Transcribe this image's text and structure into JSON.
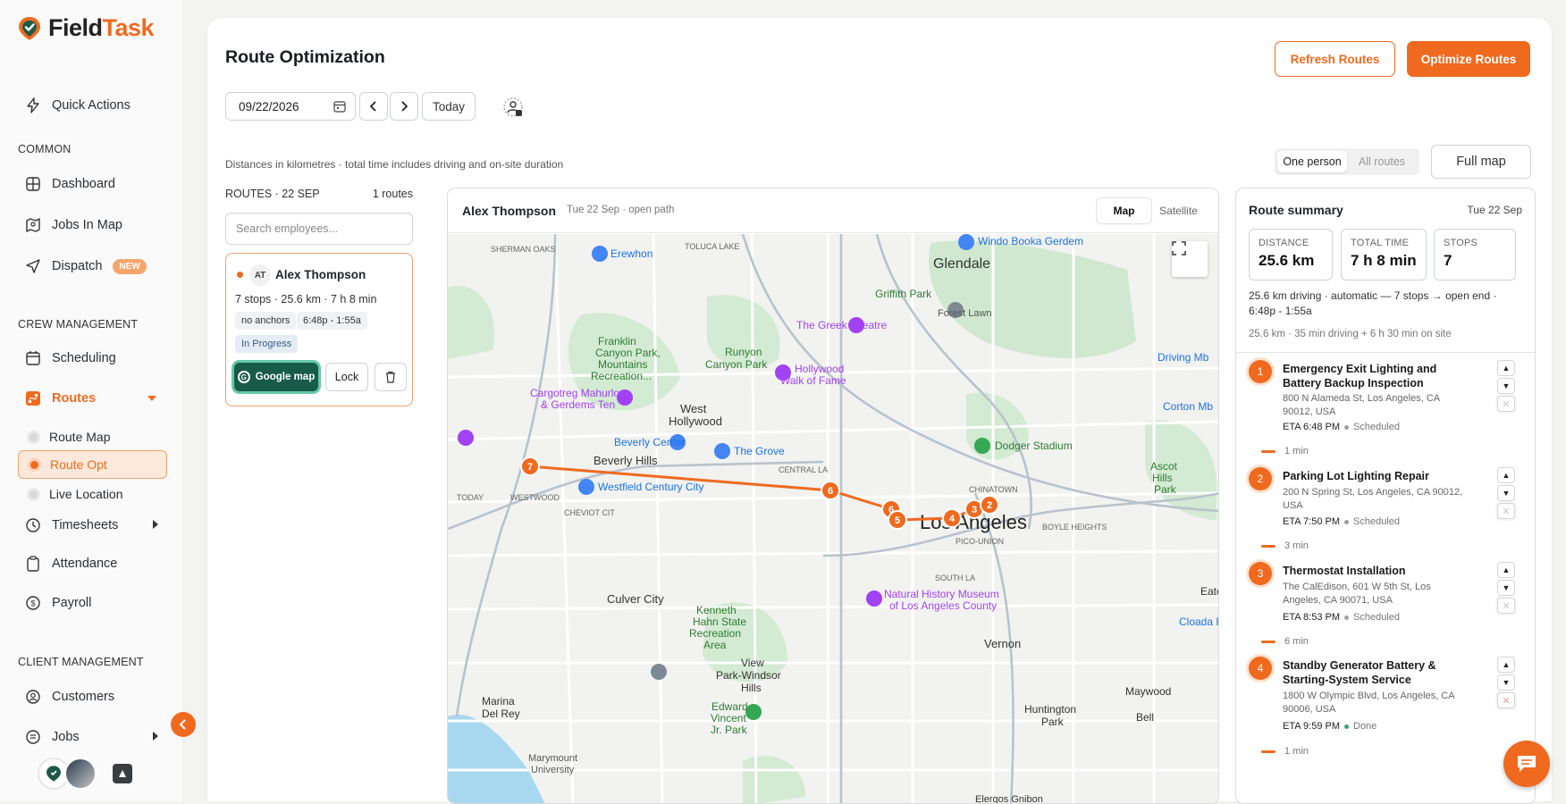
{
  "brand": {
    "name_part1": "Field",
    "name_part2": "Task",
    "accent": "#ef6a1f"
  },
  "sidebar": {
    "quick_actions": "Quick Actions",
    "sections": {
      "common": "COMMON",
      "crew": "CREW MANAGEMENT",
      "client": "CLIENT MANAGEMENT"
    },
    "items": {
      "dashboard": "Dashboard",
      "jobs_in_map": "Jobs In Map",
      "dispatch": "Dispatch",
      "dispatch_badge": "NEW",
      "scheduling": "Scheduling",
      "routes": "Routes",
      "route_map": "Route Map",
      "route_opt": "Route Opt",
      "live_location": "Live Location",
      "timesheets": "Timesheets",
      "attendance": "Attendance",
      "payroll": "Payroll",
      "customers": "Customers",
      "jobs": "Jobs"
    }
  },
  "header": {
    "title": "Route Optimization",
    "refresh_label": "Refresh Routes",
    "optimize_label": "Optimize Routes",
    "date_value": "09/22/2026",
    "today_label": "Today",
    "note": "Distances in kilometres · total time includes driving and on-site duration",
    "toggle": {
      "one_person": "One person",
      "all_routes": "All routes"
    },
    "full_map_label": "Full map"
  },
  "routes_panel": {
    "title": "ROUTES · 22 SEP",
    "count": "1 routes",
    "search_placeholder": "Search employees...",
    "employee": {
      "initials": "AT",
      "name": "Alex Thompson",
      "stats": "7 stops · 25.6 km · 7 h 8 min",
      "chip_anchors": "no anchors",
      "chip_time": "6:48p - 1:55a",
      "status": "In Progress",
      "google_map_label": "Google map",
      "lock_label": "Lock"
    }
  },
  "map": {
    "employee_name": "Alex Thompson",
    "subtitle": "Tue 22 Sep · open path",
    "tabs": {
      "map": "Map",
      "satellite": "Satellite"
    },
    "labels": {
      "glendale": "Glendale",
      "los_angeles": "Los Angeles",
      "beverly_hills": "Beverly Hills",
      "west_hollywood_1": "West",
      "west_hollywood_2": "Hollywood",
      "culver_city": "Culver City",
      "vernon": "Vernon",
      "huntington_park_1": "Huntington",
      "huntington_park_2": "Park",
      "maywood": "Maywood",
      "bell": "Bell",
      "marina_del_rey_1": "Marina",
      "marina_del_rey_2": "Del Rey",
      "view_park_1": "View",
      "view_park_2": "Park-Windsor",
      "view_park_3": "Hills",
      "griffith_park": "Griffith Park",
      "forest_lawn": "Forest Lawn",
      "runyon_1": "Runyon",
      "runyon_2": "Canyon Park",
      "franklin_1": "Franklin",
      "franklin_2": "Canyon Park,",
      "franklin_3": "Mountains",
      "franklin_4": "Recreation...",
      "kenneth_1": "Kenneth",
      "kenneth_2": "Hahn State",
      "kenneth_3": "Recreation",
      "kenneth_4": "Area",
      "edward_1": "Edward",
      "edward_2": "Vincent",
      "edward_3": "Jr. Park",
      "ascot_1": "Ascot",
      "ascot_2": "Hills",
      "ascot_3": "Park",
      "erewhon": "Erewhon",
      "greek_theatre": "The Greek Theatre",
      "hollywood_walk_1": "Hollywood",
      "hollywood_walk_2": "Walk of Fame",
      "beverly_center": "Beverly Center",
      "the_grove": "The Grove",
      "westfield": "Westfield Century City",
      "dodger": "Dodger Stadium",
      "nhm_1": "Natural History Museum",
      "nhm_2": "of Los Angeles County",
      "carg_1": "Cargotreg Mahurlog",
      "carg_2": "& Gerdems Ten",
      "windo": "Windo Booka Gerdem",
      "cortonmb": "Corton Mb",
      "drivingmb": "Driving Mb",
      "cloada": "Cloada Ra",
      "eatc": "Eatc",
      "marymount_1": "Marymount",
      "marymount_2": "University",
      "elergos": "Elergos Gnibon",
      "sherman": "SHERMAN OAKS",
      "toluca": "TOLUCA LAKE",
      "westwood": "WESTWOOD",
      "central": "CENTRAL LA",
      "pico": "PICO-UNION",
      "chinatown": "CHINATOWN",
      "today": "TODAY",
      "cheviot": "CHEVIOT CIT",
      "south": "SOUTH LA",
      "boyle": "BOYLE HEIGHTS"
    },
    "markers": [
      "7",
      "6",
      "6",
      "5",
      "4",
      "3",
      "2"
    ]
  },
  "summary": {
    "title": "Route summary",
    "date": "Tue 22 Sep",
    "distance_label": "DISTANCE",
    "distance_value": "25.6 km",
    "time_label": "TOTAL TIME",
    "time_value": "7 h 8 min",
    "stops_label": "STOPS",
    "stops_value": "7",
    "line1": "25.6 km driving · automatic — 7 stops → open end · 6:48p - 1:55a",
    "line2": "25.6 km · 35 min driving + 6 h 30 min on site",
    "stops": [
      {
        "num": "1",
        "title": "Emergency Exit Lighting and Battery Backup Inspection",
        "address": "800 N Alameda St, Los Angeles, CA 90012, USA",
        "eta": "ETA 6:48 PM",
        "status": "Scheduled",
        "drive": "1 min"
      },
      {
        "num": "2",
        "title": "Parking Lot Lighting Repair",
        "address": "200 N Spring St, Los Angeles, CA 90012, USA",
        "eta": "ETA 7:50 PM",
        "status": "Scheduled",
        "drive": "3 min"
      },
      {
        "num": "3",
        "title": "Thermostat Installation",
        "address": "The CalEdison, 601 W 5th St, Los Angeles, CA 90071, USA",
        "eta": "ETA 8:53 PM",
        "status": "Scheduled",
        "drive": "6 min"
      },
      {
        "num": "4",
        "title": "Standby Generator Battery & Starting-System Service",
        "address": "1800 W Olympic Blvd, Los Angeles, CA 90006, USA",
        "eta": "ETA 9:59 PM",
        "status": "Done",
        "drive": "1 min"
      }
    ]
  }
}
